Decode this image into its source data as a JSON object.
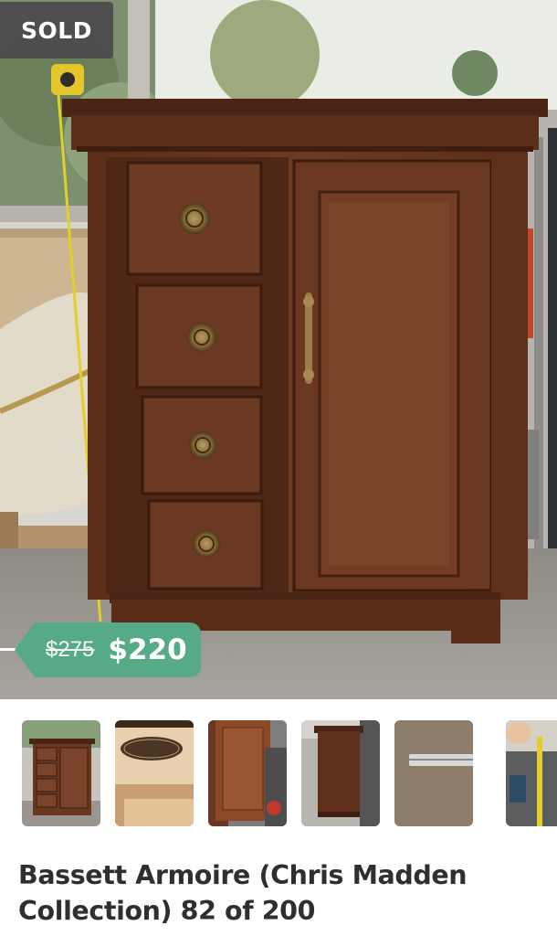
{
  "listing": {
    "status_badge": "SOLD",
    "original_price": "$275",
    "current_price": "$220",
    "title": "Bassett Armoire (Chris Madden Collection) 82 of 200"
  },
  "gallery": {
    "thumbnails": [
      {
        "subject": "armoire-front-view"
      },
      {
        "subject": "maker-label-inside-drawer"
      },
      {
        "subject": "cabinet-door-closeup"
      },
      {
        "subject": "armoire-side-view"
      },
      {
        "subject": "tape-measure-on-carpet"
      },
      {
        "subject": "tape-measure-height"
      }
    ]
  },
  "colors": {
    "price_tag": "#56aa86",
    "sold_badge": "#4b4b4b",
    "title_text": "#2f2f2f"
  }
}
